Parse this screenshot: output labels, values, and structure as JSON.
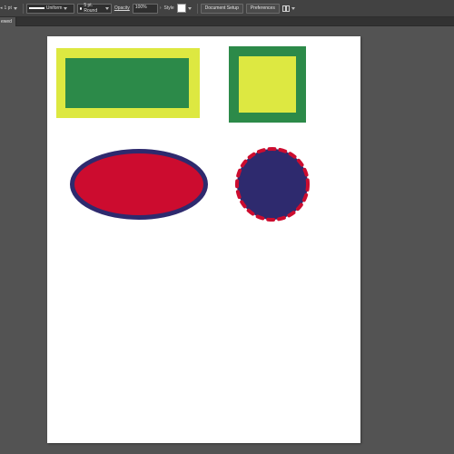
{
  "control_bar": {
    "stroke_weight": "1 pt",
    "stroke_profile": "Uniform",
    "brush_label": "5 pt. Round",
    "opacity_label": "Opacity",
    "opacity_value": "100%",
    "style_label": "Style",
    "document_setup_label": "Document Setup",
    "preferences_label": "Preferences"
  },
  "document_tab": {
    "label": "ewed"
  },
  "colors": {
    "workspace": "#535353",
    "yellow": "#dde841",
    "green": "#2c8a49",
    "red": "#cc0c2f",
    "navy": "#2e2a6e"
  }
}
